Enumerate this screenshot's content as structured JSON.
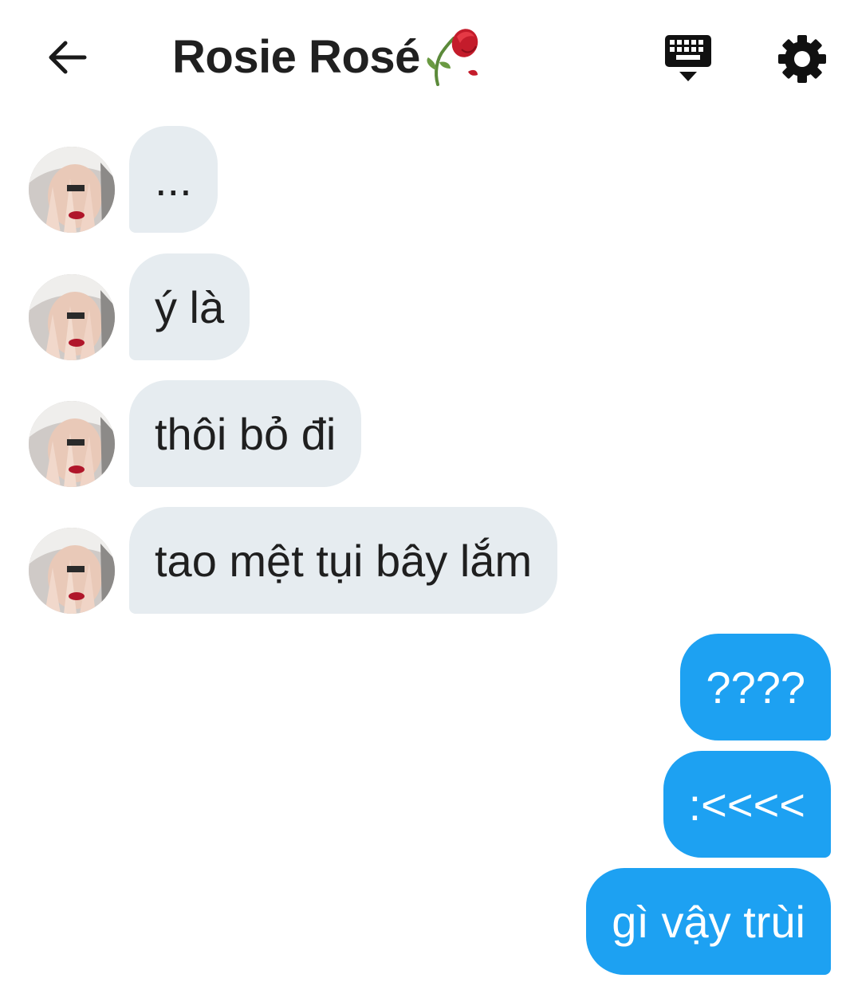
{
  "header": {
    "title": "Rosie Rosé",
    "back_icon": "arrow-left-icon",
    "title_emoji": "wilted-rose-icon",
    "keyboard_icon": "keyboard-hide-icon",
    "settings_icon": "gear-icon"
  },
  "colors": {
    "incoming_bubble": "#e6ecf0",
    "outgoing_bubble": "#1da1f2",
    "outgoing_text": "#ffffff",
    "text": "#1f1f1f"
  },
  "messages": {
    "incoming": [
      {
        "text": "..."
      },
      {
        "text": "ý là"
      },
      {
        "text": "thôi bỏ đi"
      },
      {
        "text": "tao mệt tụi bây lắm"
      }
    ],
    "outgoing": [
      {
        "text": "????"
      },
      {
        "text": ":<<<<"
      },
      {
        "text": "gì vậy trùi"
      }
    ]
  }
}
